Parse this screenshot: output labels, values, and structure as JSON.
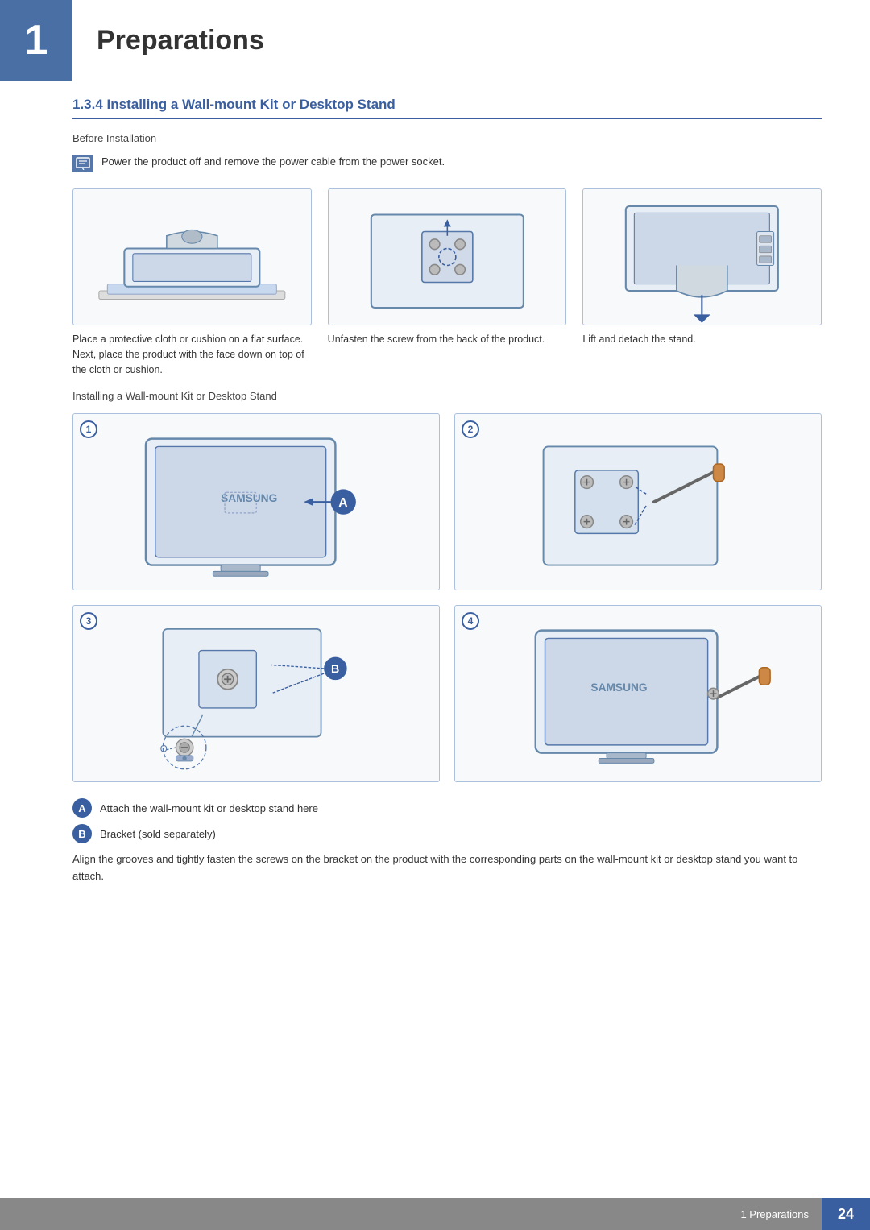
{
  "chapter": {
    "number": "1",
    "title": "Preparations"
  },
  "section": {
    "id": "1.3.4",
    "heading": "1.3.4   Installing a Wall-mount Kit or Desktop Stand"
  },
  "before_installation": {
    "label": "Before Installation",
    "note": "Power the product off and remove the power cable from the power socket."
  },
  "step_images": [
    {
      "caption": "Place a protective cloth or cushion on a flat surface. Next, place the product with the face down on top of the cloth or cushion."
    },
    {
      "caption": "Unfasten the screw from the back of the product."
    },
    {
      "caption": "Lift and detach the stand."
    }
  ],
  "install_section_label": "Installing a Wall-mount Kit or Desktop Stand",
  "steps": [
    {
      "number": "1"
    },
    {
      "number": "2"
    },
    {
      "number": "3"
    },
    {
      "number": "4"
    }
  ],
  "legend": [
    {
      "letter": "A",
      "text": "Attach the wall-mount kit or desktop stand here"
    },
    {
      "letter": "B",
      "text": "Bracket (sold separately)"
    }
  ],
  "final_text": "Align the grooves and tightly fasten the screws on the bracket on the product with the corresponding parts on the wall-mount kit or desktop stand you want to attach.",
  "footer": {
    "chapter_label": "1 Preparations",
    "page_number": "24"
  }
}
